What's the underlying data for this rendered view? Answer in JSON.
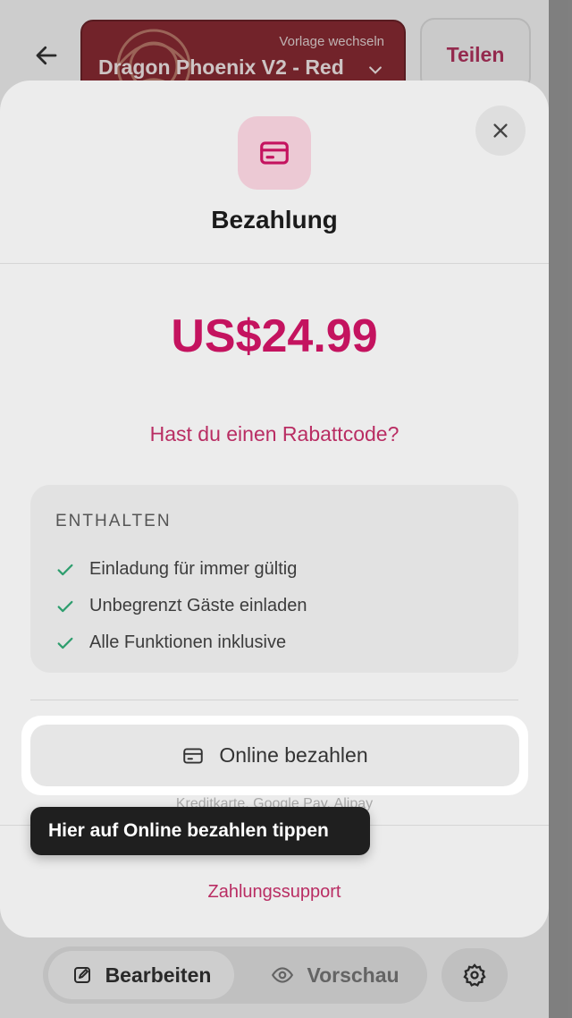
{
  "header": {
    "template_hint": "Vorlage wechseln",
    "template_name": "Dragon Phoenix V2 - Red",
    "share_label": "Teilen"
  },
  "payment_sheet": {
    "title": "Bezahlung",
    "price": "US$24.99",
    "coupon_link": "Hast du einen Rabattcode?",
    "included": {
      "title": "ENTHALTEN",
      "items": [
        "Einladung für immer gültig",
        "Unbegrenzt Gäste einladen",
        "Alle Funktionen inklusive"
      ]
    },
    "pay_online_label": "Online bezahlen",
    "methods_caption": "Kreditkarte, Google Pay, Alipay",
    "support_link": "Zahlungssupport"
  },
  "tooltip": {
    "text": "Hier auf Online bezahlen tippen"
  },
  "bottom_nav": {
    "edit_label": "Bearbeiten",
    "preview_label": "Vorschau"
  },
  "colors": {
    "accent": "#c4135f",
    "link": "#b92d63",
    "check": "#2e9e6e",
    "tooltip_bg": "#1f1f1f"
  }
}
